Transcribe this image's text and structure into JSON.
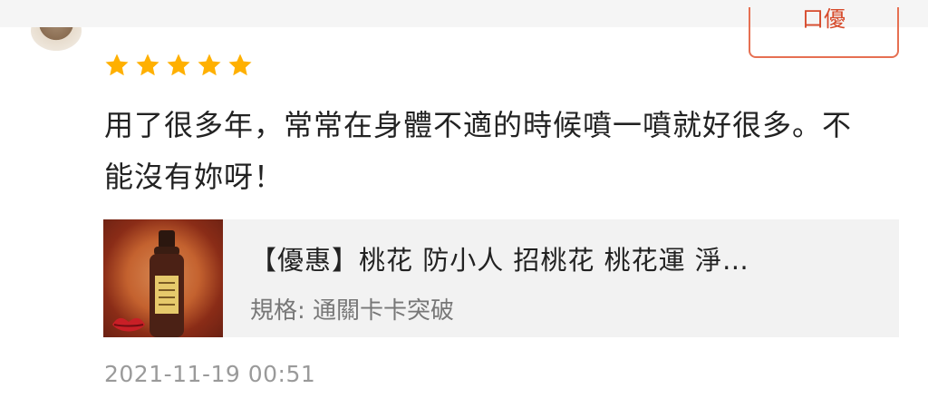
{
  "review": {
    "rating": 5,
    "rating_max": 5,
    "star_color": "#ffb000",
    "text": "用了很多年，常常在身體不適的時候噴一噴就好很多。不能沒有妳呀！"
  },
  "header": {
    "tag_button_label": "口優"
  },
  "product": {
    "title": "【優惠】桃花 防小人 招桃花 桃花運 淨…",
    "spec": "規格: 通關卡卡突破"
  },
  "timestamp": "2021-11-19 00:51",
  "colors": {
    "accent": "#e67052",
    "text": "#222222",
    "muted": "#9a9a9a",
    "card_bg": "#f2f2f2"
  },
  "icons": {
    "star": "star-icon",
    "avatar": "user-avatar"
  }
}
